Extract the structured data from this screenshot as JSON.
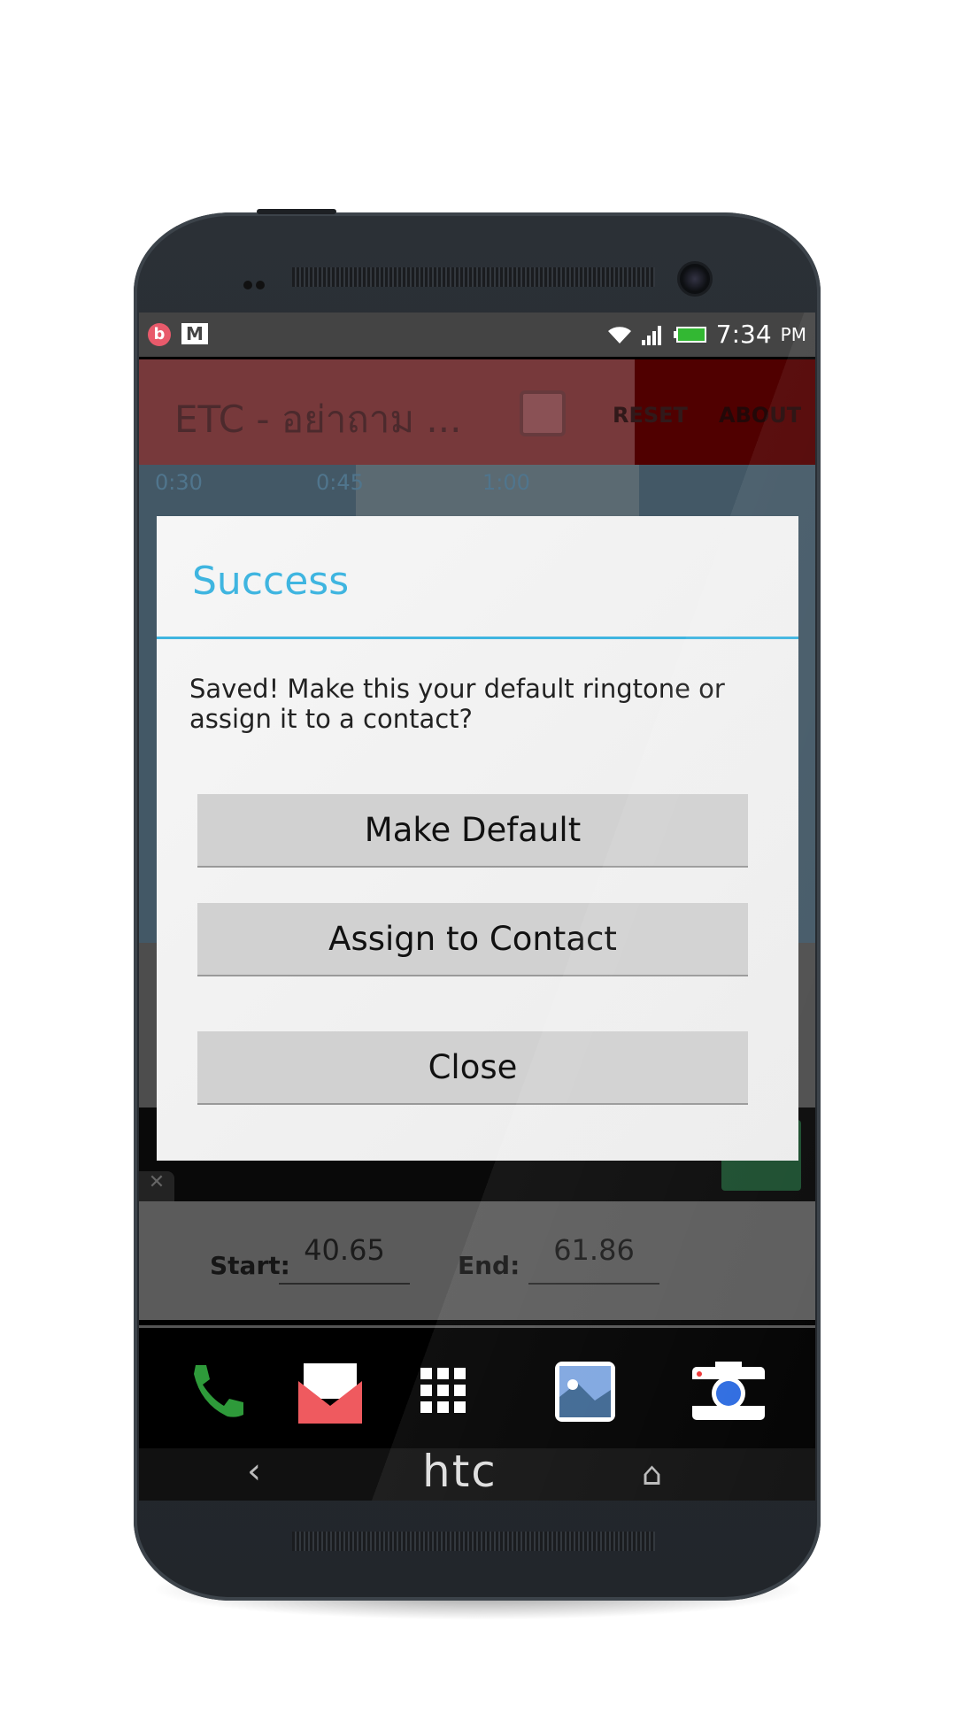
{
  "status_bar": {
    "time": "7:34",
    "ampm": "PM",
    "icons": [
      "beats-icon",
      "gmail-icon",
      "wifi-icon",
      "signal-icon",
      "battery-icon"
    ]
  },
  "app_bar": {
    "title": "ETC - อย่าถาม ...",
    "reset_label": "RESET",
    "about_label": "ABOUT"
  },
  "timeline": {
    "ticks": [
      "0:30",
      "0:45",
      "1:00"
    ]
  },
  "dialog": {
    "title": "Success",
    "message": "Saved! Make this your default ringtone or assign it to a contact?",
    "buttons": [
      "Make Default",
      "Assign to Contact",
      "Close"
    ],
    "accent": "#3fb5e0"
  },
  "ad": {
    "close": "✕"
  },
  "trim": {
    "start_label": "Start:",
    "start_value": "40.65",
    "end_label": "End:",
    "end_value": "61.86"
  },
  "dock": [
    "phone-icon",
    "mail-icon",
    "apps-icon",
    "gallery-icon",
    "camera-icon"
  ],
  "nav": {
    "back": "‹",
    "brand": "htc",
    "home": "⌂"
  }
}
